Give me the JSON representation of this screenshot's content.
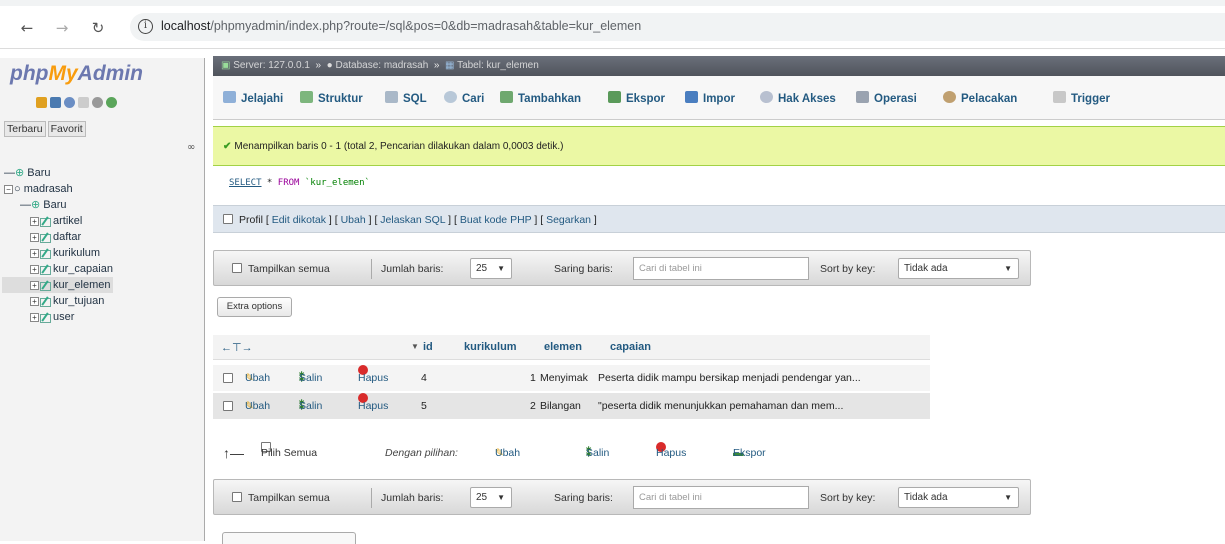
{
  "browser": {
    "url_host": "localhost",
    "url_path": "/phpmyadmin/index.php?route=/sql&pos=0&db=madrasah&table=kur_elemen"
  },
  "nav": {
    "logo_php": "php",
    "logo_my": "My",
    "logo_admin": "Admin",
    "tab_recent": "Terbaru",
    "tab_favorite": "Favorit",
    "tree": [
      {
        "label": "Baru",
        "level": 0
      },
      {
        "label": "madrasah",
        "level": 0
      },
      {
        "label": "Baru",
        "level": 1
      },
      {
        "label": "artikel",
        "level": 1
      },
      {
        "label": "daftar",
        "level": 1
      },
      {
        "label": "kurikulum",
        "level": 1
      },
      {
        "label": "kur_capaian",
        "level": 1
      },
      {
        "label": "kur_elemen",
        "level": 1
      },
      {
        "label": "kur_tujuan",
        "level": 1
      },
      {
        "label": "user",
        "level": 1
      }
    ]
  },
  "breadcrumb": {
    "server": "Server: 127.0.0.1",
    "database": "Database: madrasah",
    "table": "Tabel: kur_elemen"
  },
  "tabs": [
    "Jelajahi",
    "Struktur",
    "SQL",
    "Cari",
    "Tambahkan",
    "Ekspor",
    "Impor",
    "Hak Akses",
    "Operasi",
    "Pelacakan",
    "Trigger"
  ],
  "message": {
    "success": "Menampilkan baris 0 - 1 (total 2, Pencarian dilakukan dalam 0,0003 detik.)"
  },
  "sql": {
    "select": "SELECT",
    "star": " * ",
    "from": "FROM",
    "table": " `kur_elemen`"
  },
  "profil": {
    "label": "Profil",
    "links": [
      "Edit dikotak",
      "Ubah",
      "Jelaskan SQL",
      "Buat kode PHP",
      "Segarkan"
    ]
  },
  "filter": {
    "show_all": "Tampilkan semua",
    "rows_label": "Jumlah baris:",
    "rows_value": "25",
    "filter_label": "Saring baris:",
    "filter_placeholder": "Cari di tabel ini",
    "sort_label": "Sort by key:",
    "sort_value": "Tidak ada"
  },
  "extra_options": "Extra options",
  "table": {
    "columns": [
      "id",
      "kurikulum",
      "elemen",
      "capaian"
    ],
    "rows": [
      {
        "id": "4",
        "kurikulum": "1",
        "elemen": "Menyimak",
        "capaian": "Peserta didik mampu bersikap menjadi pendengar yan..."
      },
      {
        "id": "5",
        "kurikulum": "2",
        "elemen": "Bilangan",
        "capaian": "\"peserta  didik  menunjukkan  pemahaman  dan  mem..."
      }
    ],
    "actions": {
      "edit": "Ubah",
      "copy": "Salin",
      "delete": "Hapus"
    }
  },
  "bulk": {
    "check_all": "Pilih Semua",
    "with_selected": "Dengan pilihan:",
    "edit": "Ubah",
    "copy": "Salin",
    "delete": "Hapus",
    "export": "Ekspor"
  }
}
